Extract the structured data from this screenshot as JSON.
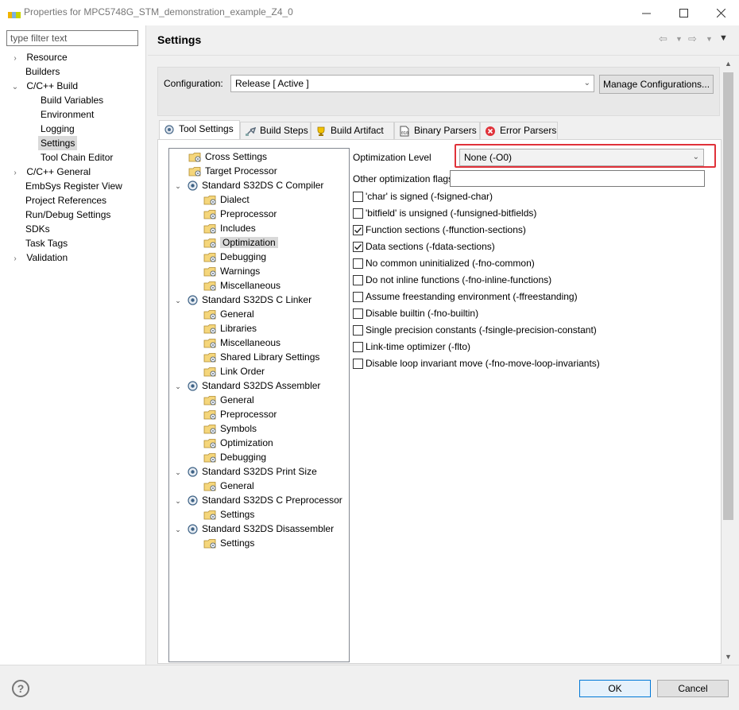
{
  "window": {
    "title": "Properties for MPC5748G_STM_demonstration_example_Z4_0",
    "logo": "NXP",
    "minimize_icon": "minimize-icon",
    "maximize_icon": "maximize-icon",
    "close_icon": "close-icon"
  },
  "sidebar": {
    "filter_placeholder": "type filter text",
    "items": [
      {
        "label": "Resource",
        "level": 0,
        "expander": "collapsed"
      },
      {
        "label": "Builders",
        "level": 0,
        "expander": "none"
      },
      {
        "label": "C/C++ Build",
        "level": 0,
        "expander": "expanded"
      },
      {
        "label": "Build Variables",
        "level": 1,
        "expander": "none"
      },
      {
        "label": "Environment",
        "level": 1,
        "expander": "none"
      },
      {
        "label": "Logging",
        "level": 1,
        "expander": "none"
      },
      {
        "label": "Settings",
        "level": 1,
        "expander": "none",
        "selected": true
      },
      {
        "label": "Tool Chain Editor",
        "level": 1,
        "expander": "none"
      },
      {
        "label": "C/C++ General",
        "level": 0,
        "expander": "collapsed"
      },
      {
        "label": "EmbSys Register View",
        "level": 0,
        "expander": "none"
      },
      {
        "label": "Project References",
        "level": 0,
        "expander": "none"
      },
      {
        "label": "Run/Debug Settings",
        "level": 0,
        "expander": "none"
      },
      {
        "label": "SDKs",
        "level": 0,
        "expander": "none"
      },
      {
        "label": "Task Tags",
        "level": 0,
        "expander": "none"
      },
      {
        "label": "Validation",
        "level": 0,
        "expander": "collapsed"
      }
    ]
  },
  "header": {
    "title": "Settings"
  },
  "configuration": {
    "label": "Configuration:",
    "value": "Release  [ Active ]",
    "manage_button": "Manage Configurations..."
  },
  "tabs": [
    {
      "label": "Tool Settings",
      "icon": "gear-icon",
      "active": true
    },
    {
      "label": "Build Steps",
      "icon": "build-steps-icon"
    },
    {
      "label": "Build Artifact",
      "icon": "trophy-icon"
    },
    {
      "label": "Binary Parsers",
      "icon": "binary-file-icon"
    },
    {
      "label": "Error Parsers",
      "icon": "error-icon"
    }
  ],
  "tool_tree": [
    {
      "label": "Cross Settings",
      "type": "folder",
      "level": 0
    },
    {
      "label": "Target Processor",
      "type": "folder",
      "level": 0
    },
    {
      "label": "Standard S32DS C Compiler",
      "type": "tool",
      "level": 0
    },
    {
      "label": "Dialect",
      "type": "folder",
      "level": 1
    },
    {
      "label": "Preprocessor",
      "type": "folder",
      "level": 1
    },
    {
      "label": "Includes",
      "type": "folder",
      "level": 1
    },
    {
      "label": "Optimization",
      "type": "folder",
      "level": 1,
      "selected": true
    },
    {
      "label": "Debugging",
      "type": "folder",
      "level": 1
    },
    {
      "label": "Warnings",
      "type": "folder",
      "level": 1
    },
    {
      "label": "Miscellaneous",
      "type": "folder",
      "level": 1
    },
    {
      "label": "Standard S32DS C Linker",
      "type": "tool",
      "level": 0
    },
    {
      "label": "General",
      "type": "folder",
      "level": 1
    },
    {
      "label": "Libraries",
      "type": "folder",
      "level": 1
    },
    {
      "label": "Miscellaneous",
      "type": "folder",
      "level": 1
    },
    {
      "label": "Shared Library Settings",
      "type": "folder",
      "level": 1
    },
    {
      "label": "Link Order",
      "type": "folder",
      "level": 1
    },
    {
      "label": "Standard S32DS Assembler",
      "type": "tool",
      "level": 0
    },
    {
      "label": "General",
      "type": "folder",
      "level": 1
    },
    {
      "label": "Preprocessor",
      "type": "folder",
      "level": 1
    },
    {
      "label": "Symbols",
      "type": "folder",
      "level": 1
    },
    {
      "label": "Optimization",
      "type": "folder",
      "level": 1
    },
    {
      "label": "Debugging",
      "type": "folder",
      "level": 1
    },
    {
      "label": "Standard S32DS Print Size",
      "type": "tool",
      "level": 0
    },
    {
      "label": "General",
      "type": "folder",
      "level": 1
    },
    {
      "label": "Standard S32DS C Preprocessor",
      "type": "tool",
      "level": 0
    },
    {
      "label": "Settings",
      "type": "folder",
      "level": 1
    },
    {
      "label": "Standard S32DS Disassembler",
      "type": "tool",
      "level": 0
    },
    {
      "label": "Settings",
      "type": "folder",
      "level": 1
    }
  ],
  "optimization": {
    "level_label": "Optimization Level",
    "level_value": "None (-O0)",
    "other_flags_label": "Other optimization flags",
    "other_flags_value": "",
    "options": [
      {
        "label": "'char' is signed (-fsigned-char)",
        "checked": false
      },
      {
        "label": "'bitfield' is unsigned (-funsigned-bitfields)",
        "checked": false
      },
      {
        "label": "Function sections (-ffunction-sections)",
        "checked": true
      },
      {
        "label": "Data sections (-fdata-sections)",
        "checked": true
      },
      {
        "label": "No common uninitialized (-fno-common)",
        "checked": false
      },
      {
        "label": "Do not inline functions (-fno-inline-functions)",
        "checked": false
      },
      {
        "label": "Assume freestanding environment (-ffreestanding)",
        "checked": false
      },
      {
        "label": "Disable builtin (-fno-builtin)",
        "checked": false
      },
      {
        "label": "Single precision constants (-fsingle-precision-constant)",
        "checked": false
      },
      {
        "label": "Link-time optimizer (-flto)",
        "checked": false
      },
      {
        "label": "Disable loop invariant move (-fno-move-loop-invariants)",
        "checked": false
      }
    ]
  },
  "footer": {
    "help": "?",
    "ok": "OK",
    "cancel": "Cancel"
  },
  "colors": {
    "highlight_border": "#e0323a",
    "selected_bg": "#d9d9d9",
    "ok_border": "#0078d7"
  }
}
